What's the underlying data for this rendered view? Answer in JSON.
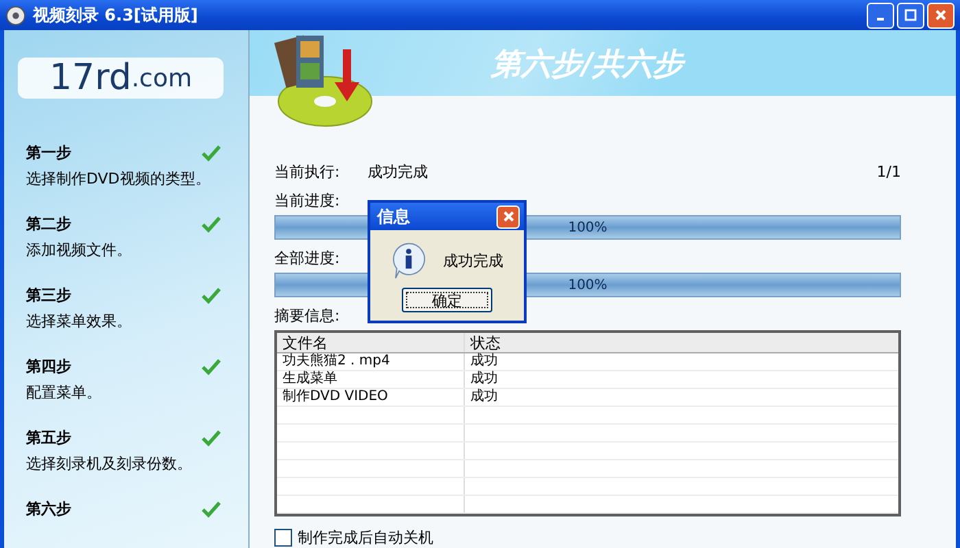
{
  "window": {
    "title": "视频刻录 6.3[试用版]"
  },
  "logo": {
    "main": "17rd",
    "suffix": ".com"
  },
  "steps": [
    {
      "title": "第一步",
      "description": "选择制作DVD视频的类型。",
      "done": true
    },
    {
      "title": "第二步",
      "description": "添加视频文件。",
      "done": true
    },
    {
      "title": "第三步",
      "description": "选择菜单效果。",
      "done": true
    },
    {
      "title": "第四步",
      "description": "配置菜单。",
      "done": true
    },
    {
      "title": "第五步",
      "description": "选择刻录机及刻录份数。",
      "done": true
    },
    {
      "title": "第六步",
      "done": true
    }
  ],
  "banner": {
    "title": "第六步/共六步"
  },
  "current": {
    "label": "当前执行:",
    "value": "成功完成",
    "count": "1/1"
  },
  "progress": [
    {
      "label": "当前进度:",
      "level": 1,
      "reading": "100%"
    },
    {
      "label": "全部进度:",
      "level": 1,
      "reading": "100%"
    }
  ],
  "summary": {
    "label": "摘要信息:",
    "columns": [
      "文件名",
      "状态"
    ],
    "rows": [
      [
        "功夫熊猫2 . mp4",
        "成功"
      ],
      [
        "生成菜单",
        "成功"
      ],
      [
        "制作DVD VIDEO",
        "成功"
      ]
    ]
  },
  "shutdown": {
    "label": "制作完成后自动关机",
    "checked": false
  },
  "dialog": {
    "title": "信息",
    "message": "成功完成",
    "button": "确定"
  }
}
